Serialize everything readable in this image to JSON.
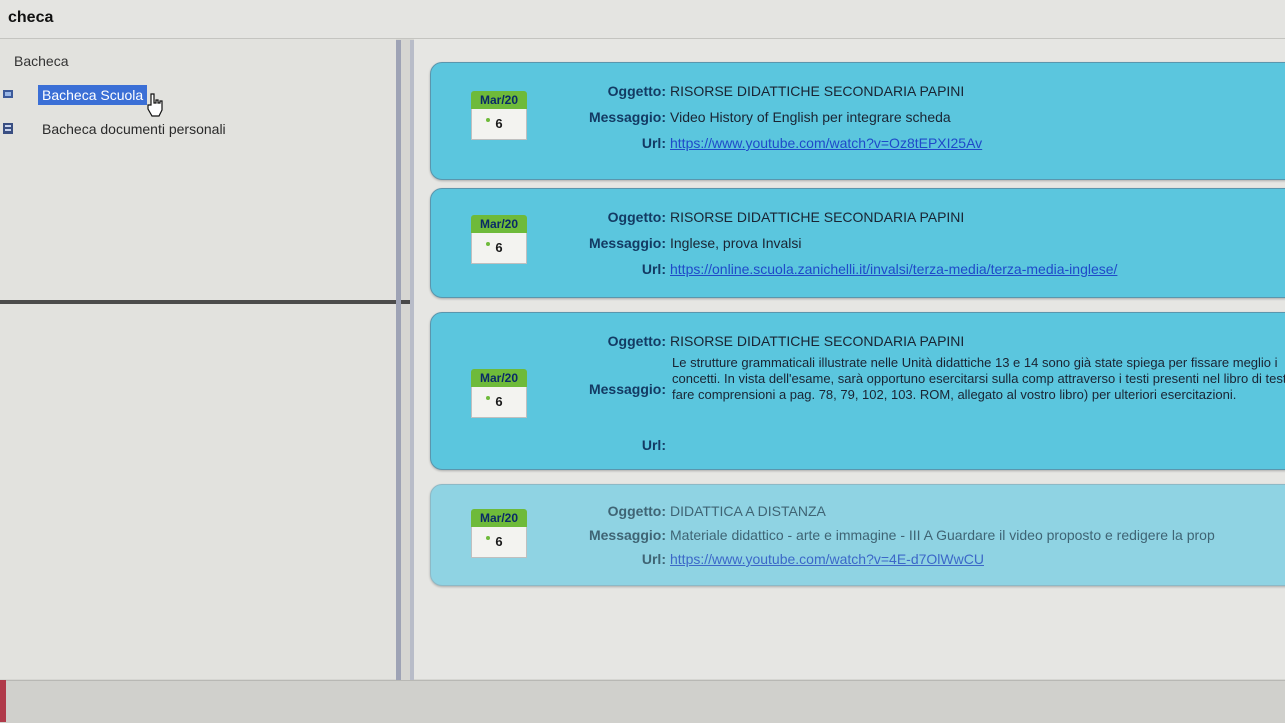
{
  "app": {
    "title": "checa"
  },
  "sidebar": {
    "heading": "Bacheca",
    "items": [
      {
        "label": "Bacheca Scuola",
        "selected": true
      },
      {
        "label": "Bacheca documenti personali",
        "selected": false
      }
    ]
  },
  "labels": {
    "oggetto": "Oggetto:",
    "messaggio": "Messaggio:",
    "url": "Url:"
  },
  "posts": [
    {
      "date_month": "Mar/20",
      "date_day": "6",
      "oggetto": "RISORSE DIDATTICHE SECONDARIA PAPINI",
      "messaggio": "Video History of English per integrare scheda",
      "url": "https://www.youtube.com/watch?v=Oz8tEPXI25Av"
    },
    {
      "date_month": "Mar/20",
      "date_day": "6",
      "oggetto": "RISORSE DIDATTICHE SECONDARIA PAPINI",
      "messaggio": "Inglese, prova Invalsi",
      "url": "https://online.scuola.zanichelli.it/invalsi/terza-media/terza-media-inglese/"
    },
    {
      "date_month": "Mar/20",
      "date_day": "6",
      "oggetto": "RISORSE DIDATTICHE SECONDARIA PAPINI",
      "messaggio": "Le strutture grammaticali illustrate nelle Unità didattiche 13 e 14 sono già state spiega per fissare meglio i concetti. In vista dell'esame, sarà opportuno esercitarsi sulla comp attraverso i testi presenti nel libro di testo: fare comprensioni a pag. 78, 79, 102, 103. ROM, allegato al vostro libro) per ulteriori esercitazioni.",
      "url": ""
    },
    {
      "date_month": "Mar/20",
      "date_day": "6",
      "oggetto": "DIDATTICA A DISTANZA",
      "messaggio": "Materiale didattico - arte e immagine - III A Guardare il video proposto e redigere la prop",
      "url": "https://www.youtube.com/watch?v=4E-d7OlWwCU"
    }
  ],
  "colors": {
    "card": "#5bc6de",
    "card_faded": "#8fd3e3",
    "selection": "#3b6fd6",
    "link": "#1f4ac9",
    "calendar_header": "#6eba3a"
  }
}
